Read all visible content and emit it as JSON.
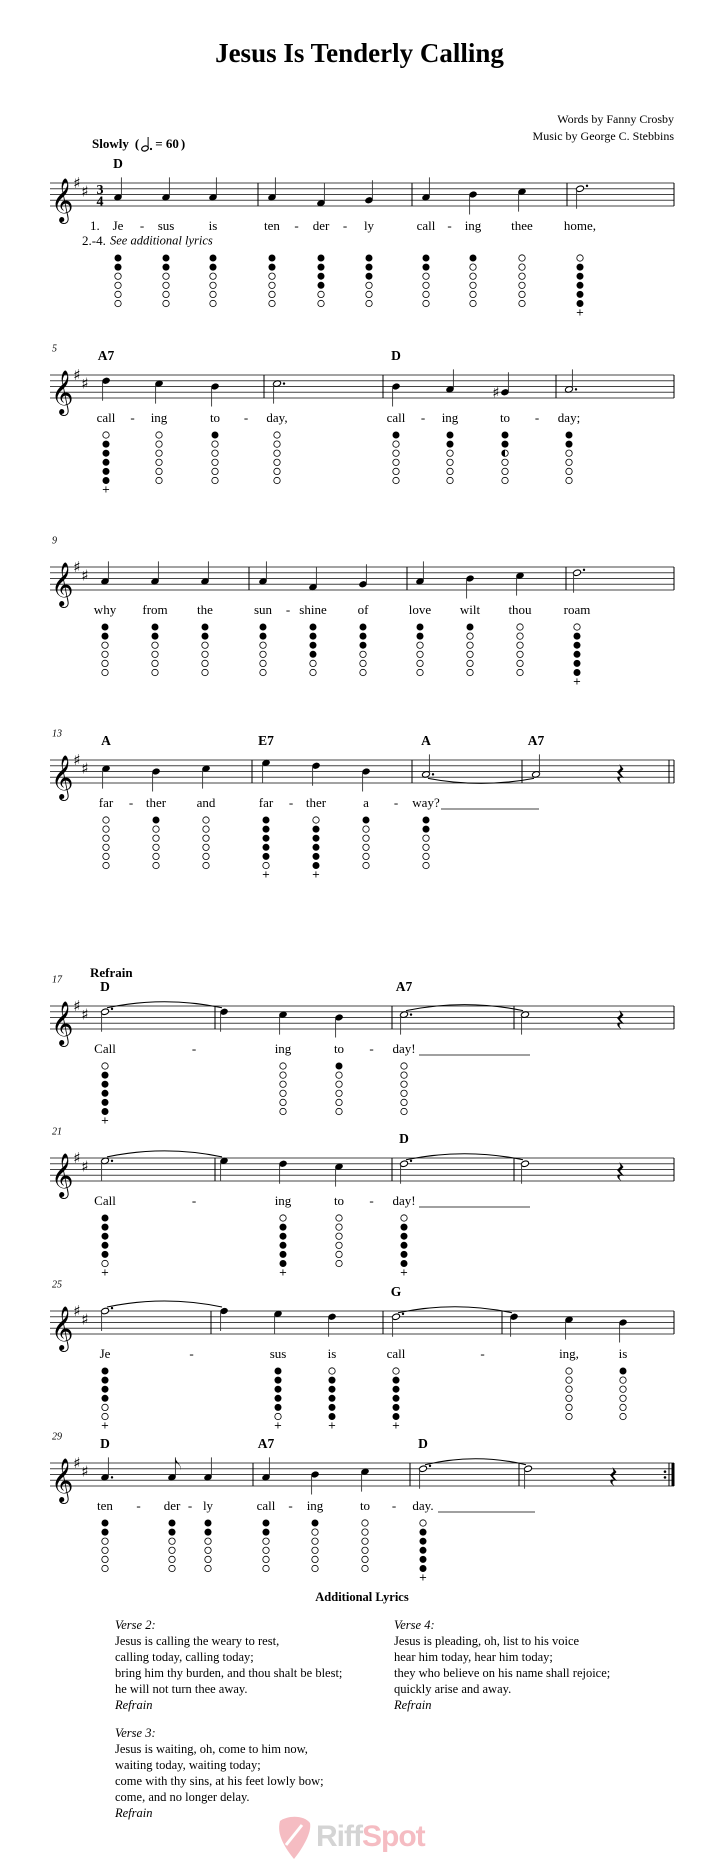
{
  "title": "Jesus Is Tenderly Calling",
  "credits": {
    "words": "Words by Fanny Crosby",
    "music": "Music by George C. Stebbins"
  },
  "tempo": {
    "label": "Slowly",
    "beat_unit": "dotted-half-note",
    "bpm_text": "= 60"
  },
  "key_signature": "D major (F♯, C♯)",
  "time_signature": {
    "top": "3",
    "bottom": "4"
  },
  "verse_labels": {
    "first": "1.",
    "others": "2.-4.",
    "others_note": "See additional lyrics"
  },
  "refrain_label": "Refrain",
  "systems": [
    {
      "measure_start": "",
      "notes": [
        {
          "p": "A4",
          "d": "q",
          "lyric": "Je",
          "hy": true,
          "f": "xxoooo"
        },
        {
          "p": "A4",
          "d": "q",
          "lyric": "sus",
          "f": "xxoooo"
        },
        {
          "p": "A4",
          "d": "q",
          "lyric": "is",
          "f": "xxoooo",
          "bar": true
        },
        {
          "p": "A4",
          "d": "q",
          "lyric": "ten",
          "hy": true,
          "f": "xxoooo"
        },
        {
          "p": "F#4",
          "d": "q",
          "lyric": "der",
          "hy": true,
          "f": "xxxxoo"
        },
        {
          "p": "G4",
          "d": "q",
          "lyric": "ly",
          "f": "xxxooo",
          "bar": true
        },
        {
          "p": "A4",
          "d": "q",
          "lyric": "call",
          "hy": true,
          "f": "xxoooo"
        },
        {
          "p": "B4",
          "d": "q",
          "lyric": "ing",
          "f": "xooooo"
        },
        {
          "p": "C#5",
          "d": "q",
          "lyric": "thee",
          "f": "oooooo",
          "bar": true
        },
        {
          "p": "D5",
          "d": "h.",
          "lyric": "home,",
          "f": "oxxxxx+"
        }
      ],
      "chords": [
        {
          "label": "D",
          "at": 0
        }
      ],
      "end": "bar"
    },
    {
      "measure_start": "5",
      "notes": [
        {
          "p": "D5",
          "d": "q",
          "lyric": "call",
          "hy": true,
          "f": "oxxxxx+"
        },
        {
          "p": "C#5",
          "d": "q",
          "lyric": "ing",
          "f": "oooooo"
        },
        {
          "p": "B4",
          "d": "q",
          "lyric": "to",
          "hy": true,
          "f": "xooooo",
          "bar": true
        },
        {
          "p": "C#5",
          "d": "h.",
          "lyric": "day,",
          "f": "oooooo",
          "bar": true
        },
        {
          "p": "B4",
          "d": "q",
          "lyric": "call",
          "hy": true,
          "f": "xooooo"
        },
        {
          "p": "A4",
          "d": "q",
          "lyric": "ing",
          "f": "xxoooo"
        },
        {
          "p": "G#4",
          "d": "q",
          "acc": "sharp",
          "lyric": "to",
          "hy": true,
          "f": "xxhooo",
          "bar": true
        },
        {
          "p": "A4",
          "d": "h.",
          "lyric": "day;",
          "f": "xxoooo"
        }
      ],
      "chords": [
        {
          "label": "A7",
          "at": 0
        },
        {
          "label": "D",
          "at": 4
        }
      ],
      "end": "bar"
    },
    {
      "measure_start": "9",
      "notes": [
        {
          "p": "A4",
          "d": "q",
          "lyric": "why",
          "f": "xxoooo"
        },
        {
          "p": "A4",
          "d": "q",
          "lyric": "from",
          "f": "xxoooo"
        },
        {
          "p": "A4",
          "d": "q",
          "lyric": "the",
          "f": "xxoooo",
          "bar": true
        },
        {
          "p": "A4",
          "d": "q",
          "lyric": "sun",
          "hy": true,
          "f": "xxoooo"
        },
        {
          "p": "F#4",
          "d": "q",
          "lyric": "shine",
          "f": "xxxxoo"
        },
        {
          "p": "G4",
          "d": "q",
          "lyric": "of",
          "f": "xxxooo",
          "bar": true
        },
        {
          "p": "A4",
          "d": "q",
          "lyric": "love",
          "f": "xxoooo"
        },
        {
          "p": "B4",
          "d": "q",
          "lyric": "wilt",
          "f": "xooooo"
        },
        {
          "p": "C#5",
          "d": "q",
          "lyric": "thou",
          "f": "oooooo",
          "bar": true
        },
        {
          "p": "D5",
          "d": "h.",
          "lyric": "roam",
          "f": "oxxxxx+"
        }
      ],
      "chords": [],
      "end": "bar"
    },
    {
      "measure_start": "13",
      "notes": [
        {
          "p": "C#5",
          "d": "q",
          "lyric": "far",
          "hy": true,
          "f": "oooooo"
        },
        {
          "p": "B4",
          "d": "q",
          "lyric": "ther",
          "f": "xooooo"
        },
        {
          "p": "C#5",
          "d": "q",
          "lyric": "and",
          "f": "oooooo",
          "bar": true
        },
        {
          "p": "E5",
          "d": "q",
          "lyric": "far",
          "hy": true,
          "f": "xxxxxo+"
        },
        {
          "p": "D5",
          "d": "q",
          "lyric": "ther",
          "f": "oxxxxx+"
        },
        {
          "p": "B4",
          "d": "q",
          "lyric": "a",
          "hy": true,
          "f": "xooooo",
          "bar": true
        },
        {
          "p": "A4",
          "d": "h.",
          "lyric": "way?",
          "ext": true,
          "tie": true,
          "f": "xxoooo",
          "bar": true
        },
        {
          "p": "A4",
          "d": "h"
        },
        {
          "p": "rest",
          "d": "q"
        }
      ],
      "chords": [
        {
          "label": "A",
          "at": 0
        },
        {
          "label": "E7",
          "at": 3
        },
        {
          "label": "A",
          "at": 6
        },
        {
          "label": "A7",
          "at": 7
        }
      ],
      "end": "double"
    },
    {
      "measure_start": "17",
      "section": "Refrain",
      "notes": [
        {
          "p": "D5",
          "d": "h.",
          "lyric": "Call",
          "hy": true,
          "tie": true,
          "f": "oxxxxx+",
          "bar": true
        },
        {
          "p": "D5",
          "d": "q"
        },
        {
          "p": "C#5",
          "d": "q",
          "lyric": "ing",
          "f": "oooooo"
        },
        {
          "p": "B4",
          "d": "q",
          "lyric": "to",
          "hy": true,
          "f": "xooooo",
          "bar": true
        },
        {
          "p": "C#5",
          "d": "h.",
          "lyric": "day!",
          "ext": true,
          "tie": true,
          "f": "oooooo",
          "bar": true
        },
        {
          "p": "C#5",
          "d": "h"
        },
        {
          "p": "rest",
          "d": "q"
        }
      ],
      "chords": [
        {
          "label": "D",
          "at": 0
        },
        {
          "label": "A7",
          "at": 4
        }
      ],
      "end": "bar"
    },
    {
      "measure_start": "21",
      "notes": [
        {
          "p": "E5",
          "d": "h.",
          "lyric": "Call",
          "hy": true,
          "tie": true,
          "f": "xxxxxo+",
          "bar": true
        },
        {
          "p": "E5",
          "d": "q"
        },
        {
          "p": "D5",
          "d": "q",
          "lyric": "ing",
          "f": "oxxxxx+"
        },
        {
          "p": "C#5",
          "d": "q",
          "lyric": "to",
          "hy": true,
          "f": "oooooo",
          "bar": true
        },
        {
          "p": "D5",
          "d": "h.",
          "lyric": "day!",
          "ext": true,
          "tie": true,
          "f": "oxxxxx+",
          "bar": true
        },
        {
          "p": "D5",
          "d": "h"
        },
        {
          "p": "rest",
          "d": "q"
        }
      ],
      "chords": [
        {
          "label": "D",
          "at": 4
        }
      ],
      "end": "bar"
    },
    {
      "measure_start": "25",
      "notes": [
        {
          "p": "F#5",
          "d": "h.",
          "lyric": "Je",
          "hy": true,
          "tie": true,
          "f": "xxxxoo+",
          "bar": true
        },
        {
          "p": "F#5",
          "d": "q"
        },
        {
          "p": "E5",
          "d": "q",
          "lyric": "sus",
          "f": "xxxxxo+"
        },
        {
          "p": "D5",
          "d": "q",
          "lyric": "is",
          "f": "oxxxxx+",
          "bar": true
        },
        {
          "p": "D5",
          "d": "h.",
          "lyric": "call",
          "hy": true,
          "tie": true,
          "f": "oxxxxx+",
          "bar": true
        },
        {
          "p": "D5",
          "d": "q"
        },
        {
          "p": "C#5",
          "d": "q",
          "lyric": "ing,",
          "f": "oooooo"
        },
        {
          "p": "B4",
          "d": "q",
          "lyric": "is",
          "f": "xooooo"
        }
      ],
      "chords": [
        {
          "label": "G",
          "at": 4
        }
      ],
      "end": "bar"
    },
    {
      "measure_start": "29",
      "notes": [
        {
          "p": "A4",
          "d": "q.",
          "lyric": "ten",
          "hy": true,
          "f": "xxoooo"
        },
        {
          "p": "A4",
          "d": "8",
          "lyric": "der",
          "hy": true,
          "f": "xxoooo"
        },
        {
          "p": "A4",
          "d": "q",
          "lyric": "ly",
          "f": "xxoooo",
          "bar": true
        },
        {
          "p": "A4",
          "d": "q",
          "lyric": "call",
          "hy": true,
          "f": "xxoooo"
        },
        {
          "p": "B4",
          "d": "q",
          "lyric": "ing",
          "f": "xooooo"
        },
        {
          "p": "C#5",
          "d": "q",
          "lyric": "to",
          "hy": true,
          "f": "oooooo",
          "bar": true
        },
        {
          "p": "D5",
          "d": "h.",
          "lyric": "day.",
          "ext": true,
          "tie": true,
          "f": "oxxxxx+",
          "bar": true
        },
        {
          "p": "D5",
          "d": "h"
        },
        {
          "p": "rest",
          "d": "q"
        }
      ],
      "chords": [
        {
          "label": "D",
          "at": 0
        },
        {
          "label": "A7",
          "at": 3
        },
        {
          "label": "D",
          "at": 6
        }
      ],
      "end": "repeat"
    }
  ],
  "additional_lyrics": {
    "heading": "Additional Lyrics",
    "verses": [
      {
        "label": "Verse 2:",
        "lines": [
          "Jesus is calling the weary to rest,",
          "calling today, calling today;",
          "bring him thy burden, and thou shalt be blest;",
          "he will not turn thee away."
        ],
        "refrain": "Refrain"
      },
      {
        "label": "Verse 3:",
        "lines": [
          "Jesus is waiting, oh, come to him now,",
          "waiting today, waiting today;",
          "come with thy sins, at his feet lowly bow;",
          "come, and no longer delay."
        ],
        "refrain": "Refrain"
      },
      {
        "label": "Verse 4:",
        "lines": [
          "Jesus is pleading, oh, list to his voice",
          "hear him today, hear him today;",
          "they who believe on his name shall rejoice;",
          "quickly arise and away."
        ],
        "refrain": "Refrain"
      }
    ]
  },
  "watermark": {
    "part1": "Riff",
    "part2": "Spot",
    "colors": {
      "gray": "#d4d4d4",
      "pink": "#f5bcc2"
    }
  }
}
